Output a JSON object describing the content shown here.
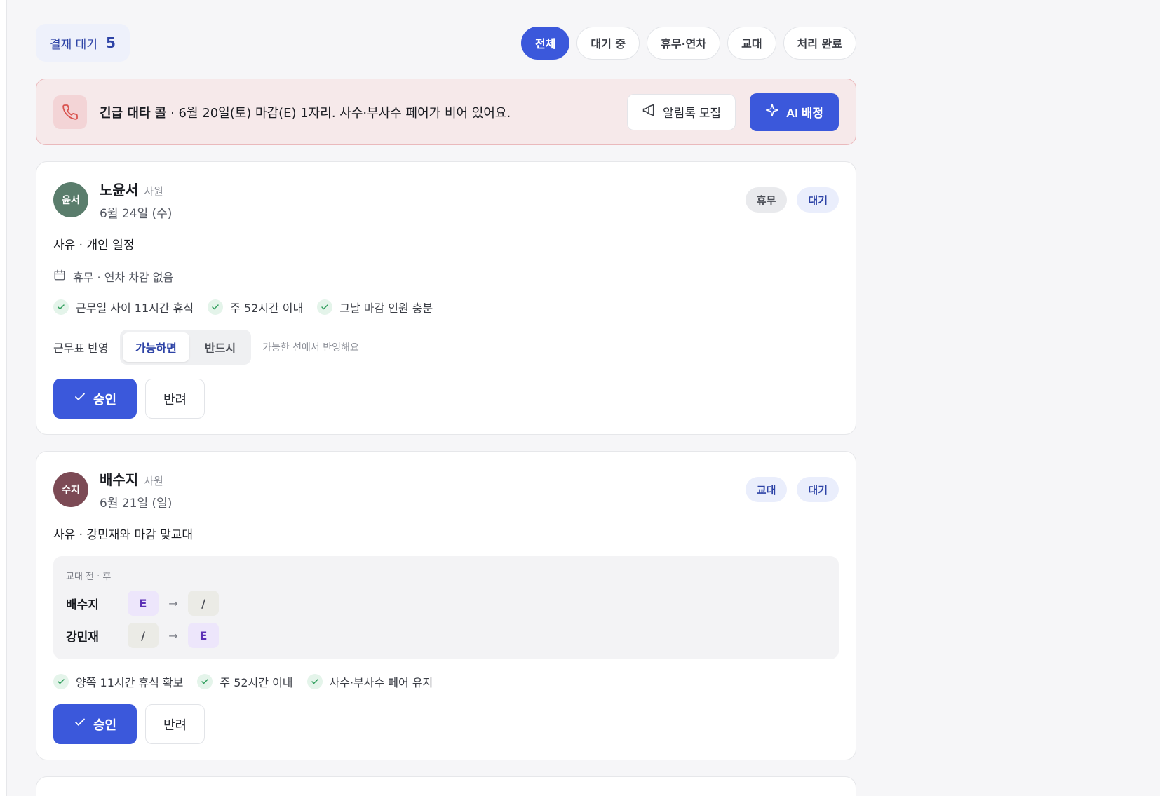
{
  "header": {
    "pending_label": "결재 대기",
    "pending_count": "5",
    "filters": [
      {
        "label": "전체",
        "active": true
      },
      {
        "label": "대기 중",
        "active": false
      },
      {
        "label": "휴무·연차",
        "active": false
      },
      {
        "label": "교대",
        "active": false
      },
      {
        "label": "처리 완료",
        "active": false
      }
    ]
  },
  "alert": {
    "title": "긴급 대타 콜",
    "message": " · 6월 20일(토) 마감(E) 1자리. 사수·부사수 페어가 비어 있어요.",
    "recruit_label": "알림톡 모집",
    "ai_label": "AI 배정"
  },
  "requests": [
    {
      "avatar_text": "윤서",
      "avatar_color": "#5a7d6c",
      "name": "노윤서",
      "role": "사원",
      "date": "6월 24일 (수)",
      "badges": [
        "휴무",
        "대기"
      ],
      "reason": "사유 · 개인 일정",
      "info": "휴무 · 연차 차감 없음",
      "checks": [
        "근무일 사이 11시간 휴식",
        "주 52시간 이내",
        "그날 마감 인원 충분"
      ],
      "apply_label": "근무표 반영",
      "apply_options": [
        "가능하면",
        "반드시"
      ],
      "apply_hint": "가능한 선에서 반영해요",
      "approve_label": "승인",
      "reject_label": "반려"
    },
    {
      "avatar_text": "수지",
      "avatar_color": "#7c4a55",
      "name": "배수지",
      "role": "사원",
      "date": "6월 21일 (일)",
      "badges": [
        "교대",
        "대기"
      ],
      "reason": "사유 · 강민재와 마감 맞교대",
      "swap_title": "교대 전 · 후",
      "swap": [
        {
          "name": "배수지",
          "before": "E",
          "after": "/"
        },
        {
          "name": "강민재",
          "before": "/",
          "after": "E"
        }
      ],
      "checks": [
        "양쪽 11시간 휴식 확보",
        "주 52시간 이내",
        "사수·부사수 페어 유지"
      ],
      "approve_label": "승인",
      "reject_label": "반려"
    }
  ]
}
